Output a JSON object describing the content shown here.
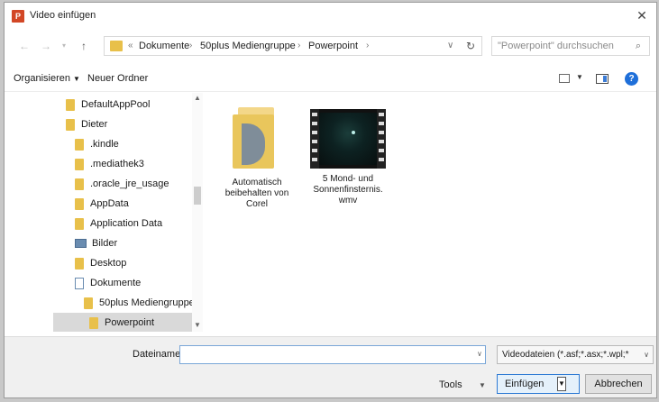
{
  "window": {
    "title": "Video einfügen",
    "app_icon_letter": "P"
  },
  "address": {
    "crumbs": [
      "Dokumente",
      "50plus Mediengruppe",
      "Powerpoint"
    ],
    "overflow": "«"
  },
  "search": {
    "placeholder": "\"Powerpoint\" durchsuchen"
  },
  "toolbar": {
    "organize_label": "Organisieren",
    "new_folder_label": "Neuer Ordner"
  },
  "tree": [
    {
      "label": "DefaultAppPool",
      "icon": "folder"
    },
    {
      "label": "Dieter",
      "icon": "folder"
    },
    {
      "label": ".kindle",
      "icon": "folder"
    },
    {
      "label": ".mediathek3",
      "icon": "folder"
    },
    {
      "label": ".oracle_jre_usage",
      "icon": "folder"
    },
    {
      "label": "AppData",
      "icon": "folder"
    },
    {
      "label": "Application Data",
      "icon": "folder"
    },
    {
      "label": "Bilder",
      "icon": "pictures"
    },
    {
      "label": "Desktop",
      "icon": "folder"
    },
    {
      "label": "Dokumente",
      "icon": "documents"
    },
    {
      "label": "50plus Mediengruppe",
      "icon": "folder"
    },
    {
      "label": "Powerpoint",
      "icon": "folder",
      "selected": true
    }
  ],
  "files": [
    {
      "name_lines": [
        "Automatisch",
        "beibehalten von",
        "Corel"
      ],
      "type": "folder"
    },
    {
      "name_lines": [
        "5 Mond- und",
        "Sonnenfinsternis.",
        "wmv"
      ],
      "type": "video"
    }
  ],
  "bottom": {
    "filename_label": "Dateiname:",
    "filename_value": "",
    "filetype": "Videodateien (*.asf;*.asx;*.wpl;*",
    "tools_label": "Tools",
    "insert_label": "Einfügen",
    "cancel_label": "Abbrechen"
  },
  "colors": {
    "accent": "#2f7bd4",
    "folder": "#e8c04a",
    "selected_row": "#d9d9d9"
  }
}
